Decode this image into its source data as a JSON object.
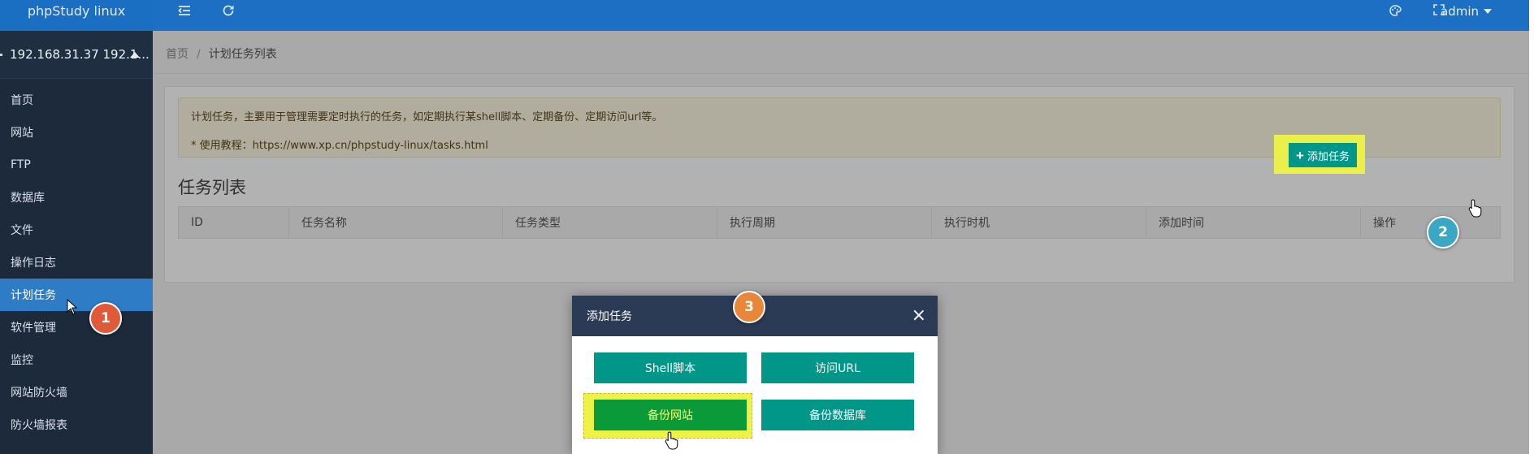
{
  "app": {
    "brand": "phpStudy linux",
    "server": "192.168.31.37 192.1..."
  },
  "sidebar": {
    "items": [
      {
        "label": "首页"
      },
      {
        "label": "网站"
      },
      {
        "label": "FTP"
      },
      {
        "label": "数据库"
      },
      {
        "label": "文件"
      },
      {
        "label": "操作日志"
      },
      {
        "label": "计划任务",
        "active": true
      },
      {
        "label": "软件管理"
      },
      {
        "label": "监控"
      },
      {
        "label": "网站防火墙"
      },
      {
        "label": "防火墙报表"
      }
    ]
  },
  "topbar": {
    "user": "admin"
  },
  "breadcrumb": {
    "home": "首页",
    "separator": "/",
    "current": "计划任务列表"
  },
  "notice": {
    "line1": "计划任务，主要用于管理需要定时执行的任务，如定期执行某shell脚本、定期备份、定期访问url等。",
    "line2": "* 使用教程：https://www.xp.cn/phpstudy-linux/tasks.html"
  },
  "tasks": {
    "title": "任务列表",
    "add_label": "添加任务",
    "columns": [
      "ID",
      "任务名称",
      "任务类型",
      "执行周期",
      "执行时机",
      "添加时间",
      "操作"
    ]
  },
  "dialog": {
    "title": "添加任务",
    "buttons": {
      "shell": "Shell脚本",
      "url": "访问URL",
      "backup_site": "备份网站",
      "backup_db": "备份数据库"
    }
  },
  "steps": [
    "1",
    "2",
    "3"
  ],
  "colors": {
    "topbar": "#1c6fc2",
    "sidebar": "#1c2a3c",
    "active_menu": "#2e7cc5",
    "primary_button": "#009688",
    "dialog_header": "#2b3a55",
    "highlight": "#eef246",
    "step1": "#e05a3a",
    "step2": "#3aa7c4",
    "step3": "#e8873a"
  },
  "icons": [
    "menu-fold-icon",
    "refresh-icon",
    "palette-icon",
    "fullscreen-icon",
    "close-icon",
    "plus-icon",
    "cursor-icon",
    "hand-cursor-icon"
  ]
}
